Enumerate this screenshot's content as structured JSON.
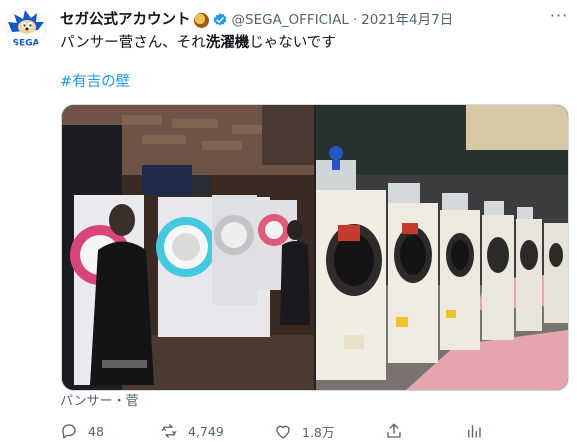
{
  "tweet": {
    "display_name": "セガ公式アカウント",
    "handle": "@SEGA_OFFICIAL",
    "separator": "·",
    "date": "2021年4月7日",
    "more_label": "···",
    "text_before": "パンサー菅さん、それ",
    "text_bold": "洗濯機",
    "text_after": "じゃないです",
    "hashtag": "#有吉の壁",
    "media_caption": "パンサー・菅",
    "avatar_text": "SEGA"
  },
  "actions": {
    "replies": "48",
    "retweets": "4,749",
    "likes": "1.8万"
  },
  "colors": {
    "link": "#1d9bf0",
    "verified": "#1d9bf0",
    "muted": "#536471",
    "avatar_bg": "#1e5fd0"
  }
}
